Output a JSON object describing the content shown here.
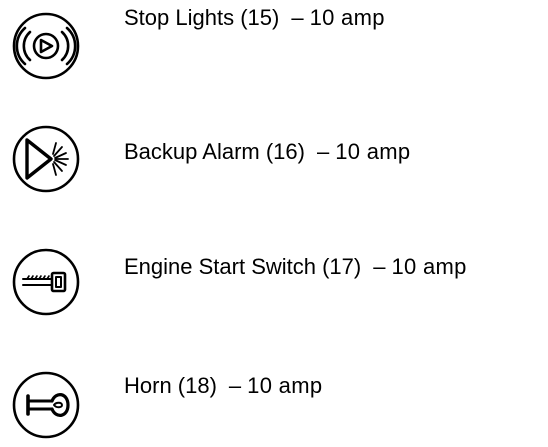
{
  "fuses": [
    {
      "name": "Stop Lights (15)",
      "dash": "–",
      "rating": "10 amp",
      "icon": "stop-lights-icon"
    },
    {
      "name": "Backup Alarm (16)",
      "dash": "–",
      "rating": "10 amp",
      "icon": "backup-alarm-icon"
    },
    {
      "name": "Engine Start Switch (17)",
      "dash": "–",
      "rating": "10 amp",
      "icon": "key-switch-icon"
    },
    {
      "name": "Horn (18)",
      "dash": "–",
      "rating": "10 amp",
      "icon": "horn-icon"
    }
  ]
}
